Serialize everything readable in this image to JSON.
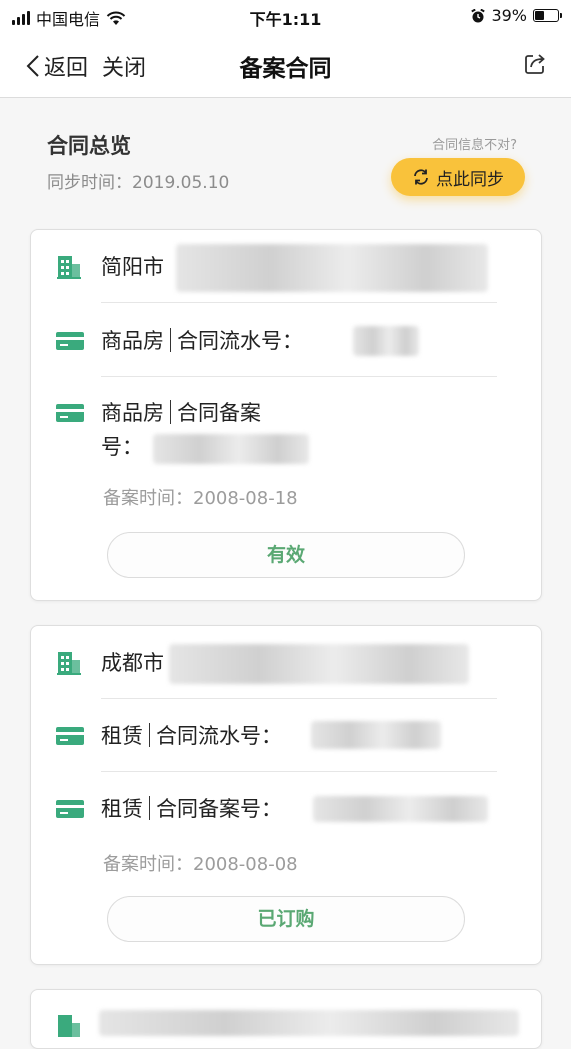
{
  "status_bar": {
    "carrier": "中国电信",
    "time": "下午1:11",
    "battery_pct": "39%",
    "battery_level": 0.39
  },
  "nav": {
    "back_label": "返回",
    "close_label": "关闭",
    "title": "备案合同"
  },
  "summary": {
    "title": "合同总览",
    "sync_time": "同步时间：2019.05.10",
    "hint": "合同信息不对?",
    "sync_button": "点此同步"
  },
  "contracts": [
    {
      "address": "简阳市",
      "serial_line": "商品房│合同流水号：",
      "type": "商品房",
      "serial_label": "合同流水号：",
      "record_label_a": "合同备案",
      "record_label_b": "号：",
      "record_date": "备案时间：2008-08-18",
      "status": "有效"
    },
    {
      "address": "成都市",
      "type": "租赁",
      "serial_label": "合同流水号：",
      "record_label": "合同备案号：",
      "record_date": "备案时间：2008-08-08",
      "status": "已订购"
    }
  ],
  "colors": {
    "accent_green": "#3aaa7d",
    "sync_yellow": "#f9c23b",
    "status_green": "#5aa873"
  }
}
